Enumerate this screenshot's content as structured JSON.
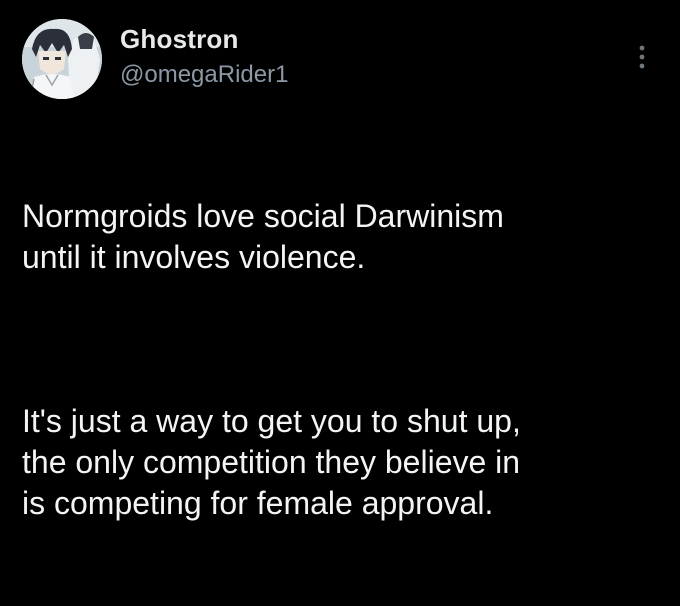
{
  "tweet": {
    "author": {
      "display_name": "Ghostron",
      "handle": "@omegaRider1",
      "avatar_icon": "anime-character-avatar"
    },
    "menu_icon": "more-options-icon",
    "paragraphs": [
      "Normgroids love social Darwinism\nuntil it involves violence.",
      "It's just a way to get you to shut up,\nthe only competition they believe in\nis competing for female approval."
    ]
  },
  "colors": {
    "background": "#000000",
    "text_primary": "#e7e9ea",
    "text_secondary": "#8b98a5"
  }
}
